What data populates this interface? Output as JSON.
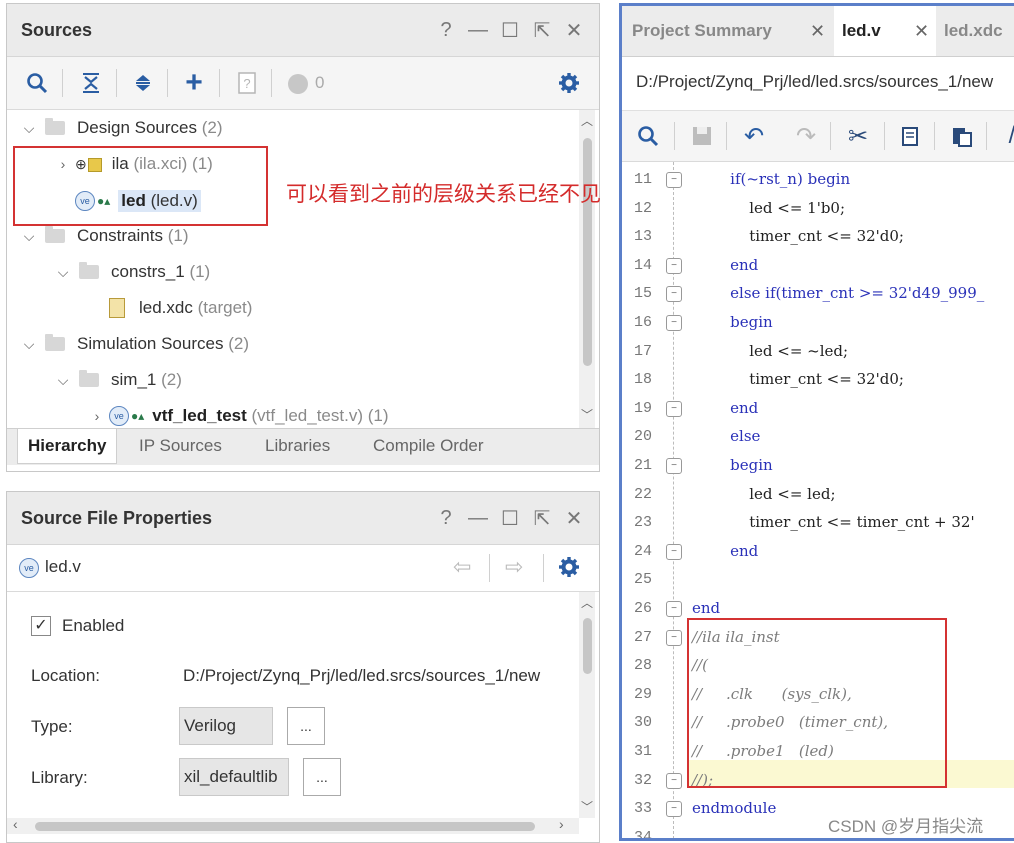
{
  "sources": {
    "title": "Sources",
    "win_buttons": [
      "?",
      "—",
      "☐",
      "⇱",
      "✕"
    ],
    "count_badge": "0",
    "tree": [
      {
        "label": "Design Sources",
        "suffix": "(2)"
      },
      {
        "label": "ila",
        "suffix": "(ila.xci) (1)"
      },
      {
        "label": "led",
        "suffix": "(led.v)"
      },
      {
        "label": "Constraints",
        "suffix": "(1)"
      },
      {
        "label": "constrs_1",
        "suffix": "(1)"
      },
      {
        "label": "led.xdc",
        "suffix": "(target)"
      },
      {
        "label": "Simulation Sources",
        "suffix": "(2)"
      },
      {
        "label": "sim_1",
        "suffix": "(2)"
      },
      {
        "label": "vtf_led_test",
        "suffix": "(vtf_led_test.v) (1)"
      }
    ],
    "tabs": [
      "Hierarchy",
      "IP Sources",
      "Libraries",
      "Compile Order"
    ]
  },
  "annotation": "可以看到之前的层级关系已经不见",
  "props": {
    "title": "Source File Properties",
    "file_name": "led.v",
    "enabled_label": "Enabled",
    "location_label": "Location:",
    "location_value": "D:/Project/Zynq_Prj/led/led.srcs/sources_1/new",
    "type_label": "Type:",
    "type_value": "Verilog",
    "library_label": "Library:",
    "library_value": "xil_defaultlib",
    "dots": "..."
  },
  "editor": {
    "tabs": [
      "Project Summary",
      "led.v",
      "led.xdc"
    ],
    "path": "D:/Project/Zynq_Prj/led/led.srcs/sources_1/new",
    "lines": [
      {
        "n": "11",
        "text": "        if(~rst_n) begin"
      },
      {
        "n": "12",
        "text": "            led <= 1'b0;"
      },
      {
        "n": "13",
        "text": "            timer_cnt <= 32'd0;"
      },
      {
        "n": "14",
        "text": "        end"
      },
      {
        "n": "15",
        "text": "        else if(timer_cnt >= 32'd49_999_"
      },
      {
        "n": "16",
        "text": "        begin"
      },
      {
        "n": "17",
        "text": "            led <= ~led;"
      },
      {
        "n": "18",
        "text": "            timer_cnt <= 32'd0;"
      },
      {
        "n": "19",
        "text": "        end"
      },
      {
        "n": "20",
        "text": "        else"
      },
      {
        "n": "21",
        "text": "        begin"
      },
      {
        "n": "22",
        "text": "            led <= led;"
      },
      {
        "n": "23",
        "text": "            timer_cnt <= timer_cnt + 32'"
      },
      {
        "n": "24",
        "text": "        end"
      },
      {
        "n": "25",
        "text": ""
      },
      {
        "n": "26",
        "text": "end"
      },
      {
        "n": "27",
        "text": "//ila ila_inst"
      },
      {
        "n": "28",
        "text": "//("
      },
      {
        "n": "29",
        "text": "//     .clk      (sys_clk),"
      },
      {
        "n": "30",
        "text": "//     .probe0   (timer_cnt),"
      },
      {
        "n": "31",
        "text": "//     .probe1   (led)"
      },
      {
        "n": "32",
        "text": "//);"
      },
      {
        "n": "33",
        "text": "endmodule"
      },
      {
        "n": "34",
        "text": ""
      }
    ]
  },
  "watermark": "CSDN @岁月指尖流"
}
